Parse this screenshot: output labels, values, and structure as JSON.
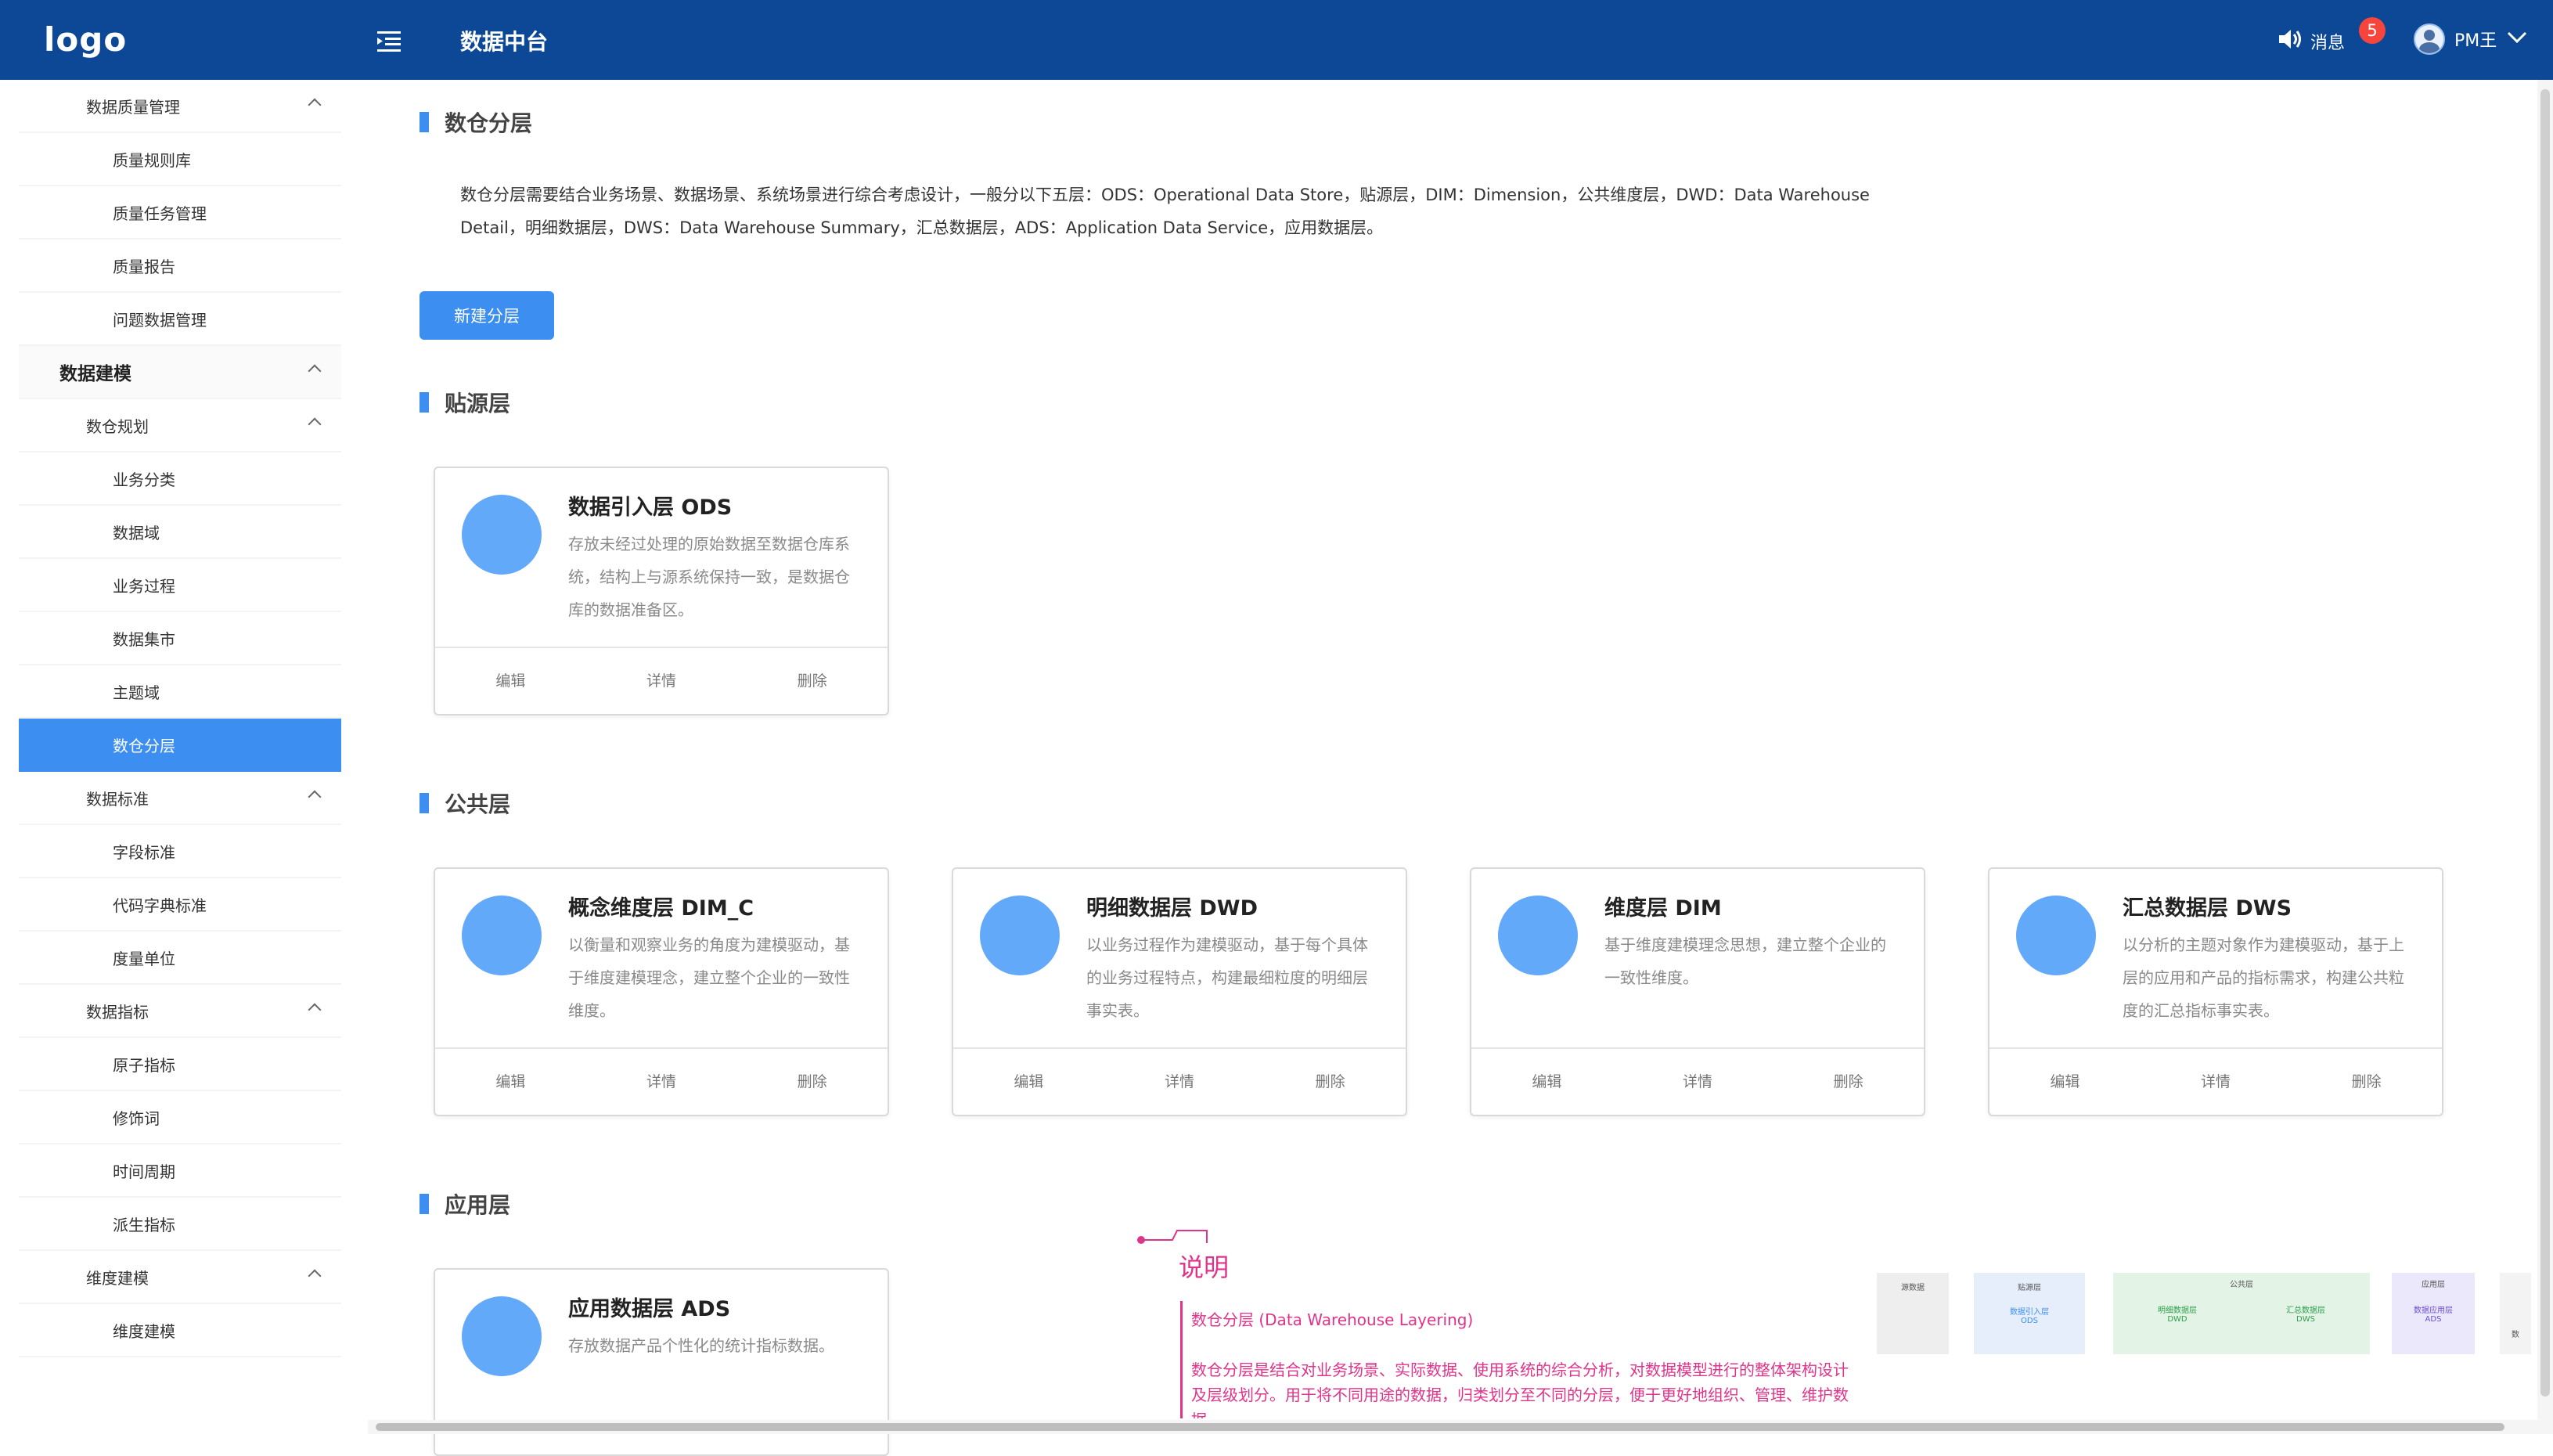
{
  "header": {
    "logo": "logo",
    "app_title": "数据中台",
    "messages_label": "消息",
    "messages_count": "5",
    "user_name": "PM王"
  },
  "sidebar": {
    "items": [
      {
        "label": "数据质量管理",
        "level": 2
      },
      {
        "label": "质量规则库",
        "level": 3
      },
      {
        "label": "质量任务管理",
        "level": 3
      },
      {
        "label": "质量报告",
        "level": 3
      },
      {
        "label": "问题数据管理",
        "level": 3
      },
      {
        "label": "数据建模",
        "level": 1
      },
      {
        "label": "数仓规划",
        "level": 2
      },
      {
        "label": "业务分类",
        "level": 3
      },
      {
        "label": "数据域",
        "level": 3
      },
      {
        "label": "业务过程",
        "level": 3
      },
      {
        "label": "数据集市",
        "level": 3
      },
      {
        "label": "主题域",
        "level": 3
      },
      {
        "label": "数仓分层",
        "level": 3,
        "active": true
      },
      {
        "label": "数据标准",
        "level": 2
      },
      {
        "label": "字段标准",
        "level": 3
      },
      {
        "label": "代码字典标准",
        "level": 3
      },
      {
        "label": "度量单位",
        "level": 3
      },
      {
        "label": "数据指标",
        "level": 2
      },
      {
        "label": "原子指标",
        "level": 3
      },
      {
        "label": "修饰词",
        "level": 3
      },
      {
        "label": "时间周期",
        "level": 3
      },
      {
        "label": "派生指标",
        "level": 3
      },
      {
        "label": "维度建模",
        "level": 2
      },
      {
        "label": "维度建模",
        "level": 3
      }
    ]
  },
  "main": {
    "page_title": "数仓分层",
    "description": "数仓分层需要结合业务场景、数据场景、系统场景进行综合考虑设计，一般分以下五层：ODS：Operational Data Store，贴源层，DIM：Dimension，公共维度层，DWD：Data Warehouse Detail，明细数据层，DWS：Data Warehouse Summary，汇总数据层，ADS：Application Data Service，应用数据层。",
    "new_button": "新建分层",
    "card_actions": {
      "edit": "编辑",
      "detail": "详情",
      "delete": "删除"
    },
    "sections": {
      "source": {
        "title": "贴源层",
        "cards": [
          {
            "title": "数据引入层  ODS",
            "text": "存放未经过处理的原始数据至数据仓库系统，结构上与源系统保持一致，是数据仓库的数据准备区。"
          }
        ]
      },
      "common": {
        "title": "公共层",
        "cards": [
          {
            "title": "概念维度层 DIM_C",
            "text": "以衡量和观察业务的角度为建模驱动，基于维度建模理念，建立整个企业的一致性维度。"
          },
          {
            "title": "明细数据层 DWD",
            "text": "以业务过程作为建模驱动，基于每个具体的业务过程特点，构建最细粒度的明细层事实表。"
          },
          {
            "title": "维度层 DIM",
            "text": "基于维度建模理念思想，建立整个企业的一致性维度。"
          },
          {
            "title": "汇总数据层 DWS",
            "text": "以分析的主题对象作为建模驱动，基于上层的应用和产品的指标需求，构建公共粒度的汇总指标事实表。"
          }
        ]
      },
      "app": {
        "title": "应用层",
        "cards": [
          {
            "title": "应用数据层 ADS",
            "text": "存放数据产品个性化的统计指标数据。"
          }
        ]
      }
    }
  },
  "annotation": {
    "title": "说明",
    "subtitle": "数仓分层 (Data Warehouse Layering)",
    "body": "数仓分层是结合对业务场景、实际数据、使用系统的综合分析，对数据模型进行的整体架构设计及层级划分。用于将不同用途的数据，归类划分至不同的分层，便于更好地组织、管理、维护数据。",
    "diagram_labels": [
      "源数据",
      "贴源层",
      "数据引入层",
      "ODS",
      "公共层",
      "明细数据层",
      "DWD",
      "汇总数据层",
      "DWS",
      "应用层",
      "数据应用层",
      "ADS",
      "数"
    ]
  },
  "colors": {
    "topbar": "#0c4896",
    "accent": "#3c8ef0",
    "circle": "#62a9fa",
    "badge": "#f5453c",
    "annotation": "#e0338a"
  }
}
